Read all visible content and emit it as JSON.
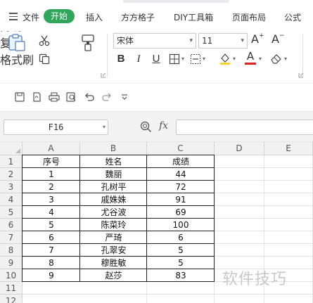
{
  "menu": {
    "file": "文件",
    "tabs": [
      "开始",
      "插入",
      "方方格子",
      "DIY工具箱",
      "页面布局",
      "公式"
    ]
  },
  "ribbon": {
    "paste": "粘贴",
    "cut": "剪切",
    "copy": "复制",
    "format_painter": "格式刷",
    "font_name": "宋体",
    "font_size": "11"
  },
  "formula_bar": {
    "cell_ref": "F16",
    "fx": "fx",
    "formula": ""
  },
  "sheet": {
    "columns": [
      "A",
      "B",
      "C",
      "D",
      "E"
    ],
    "rows": [
      "1",
      "2",
      "3",
      "4",
      "5",
      "6",
      "7",
      "8",
      "9",
      "10",
      "11",
      "12"
    ],
    "header": [
      "序号",
      "姓名",
      "成绩"
    ],
    "data": [
      [
        "1",
        "魏丽",
        "44"
      ],
      [
        "2",
        "孔树平",
        "72"
      ],
      [
        "3",
        "戚姝姝",
        "91"
      ],
      [
        "4",
        "尤谷波",
        "69"
      ],
      [
        "5",
        "陈菜玲",
        "100"
      ],
      [
        "6",
        "严琦",
        "6"
      ],
      [
        "7",
        "孔翠安",
        "5"
      ],
      [
        "8",
        "穆胜敏",
        "5"
      ],
      [
        "9",
        "赵莎",
        "83"
      ]
    ]
  },
  "watermark": "软件技巧",
  "colors": {
    "active_tab": "#2fa65a",
    "header_bg": "#f1f1f1",
    "gridline": "#e3e3e3"
  }
}
